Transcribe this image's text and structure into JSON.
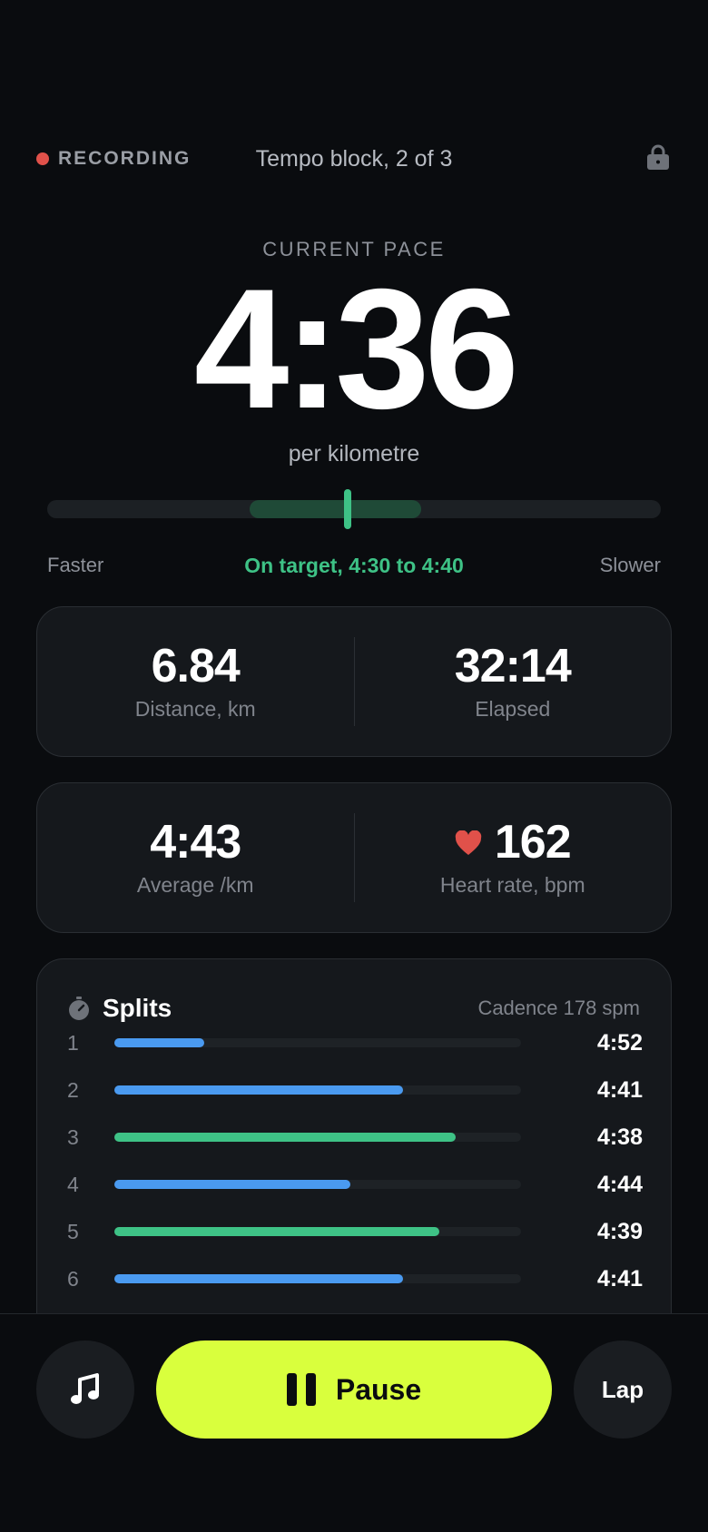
{
  "header": {
    "recording_label": "RECORDING",
    "block_title": "Tempo block, 2 of 3",
    "lock_icon": "lock-icon",
    "recording_color": "#e0514a"
  },
  "pace": {
    "label": "CURRENT PACE",
    "value": "4:36",
    "unit": "per kilometre"
  },
  "pace_range": {
    "faster_label": "Faster",
    "slower_label": "Slower",
    "status": "On target, 4:30 to 4:40",
    "target_start_fraction": 0.33,
    "target_end_fraction": 0.61,
    "current_fraction": 0.49,
    "status_color": "#3ec286"
  },
  "stats_primary": {
    "distance_value": "6.84",
    "distance_label": "Distance, km",
    "elapsed_value": "32:14",
    "elapsed_label": "Elapsed"
  },
  "stats_secondary": {
    "average_value": "4:43",
    "average_label": "Average /km",
    "heart_rate_value": "162",
    "heart_rate_label": "Heart rate, bpm",
    "heart_icon": "heart-icon"
  },
  "splits": {
    "title": "Splits",
    "cadence": "Cadence 178 spm",
    "icon": "stopwatch-icon",
    "rows": [
      {
        "num": "1",
        "time": "4:52",
        "fill": 0.22,
        "color": "#4a9af0"
      },
      {
        "num": "2",
        "time": "4:41",
        "fill": 0.71,
        "color": "#4a9af0"
      },
      {
        "num": "3",
        "time": "4:38",
        "fill": 0.84,
        "color": "#3ec286"
      },
      {
        "num": "4",
        "time": "4:44",
        "fill": 0.58,
        "color": "#4a9af0"
      },
      {
        "num": "5",
        "time": "4:39",
        "fill": 0.8,
        "color": "#3ec286"
      },
      {
        "num": "6",
        "time": "4:41",
        "fill": 0.71,
        "color": "#4a9af0"
      }
    ]
  },
  "controls": {
    "music_icon": "music-note-icon",
    "pause_label": "Pause",
    "pause_icon": "pause-icon",
    "lap_label": "Lap",
    "accent_color": "#d9ff3d"
  }
}
